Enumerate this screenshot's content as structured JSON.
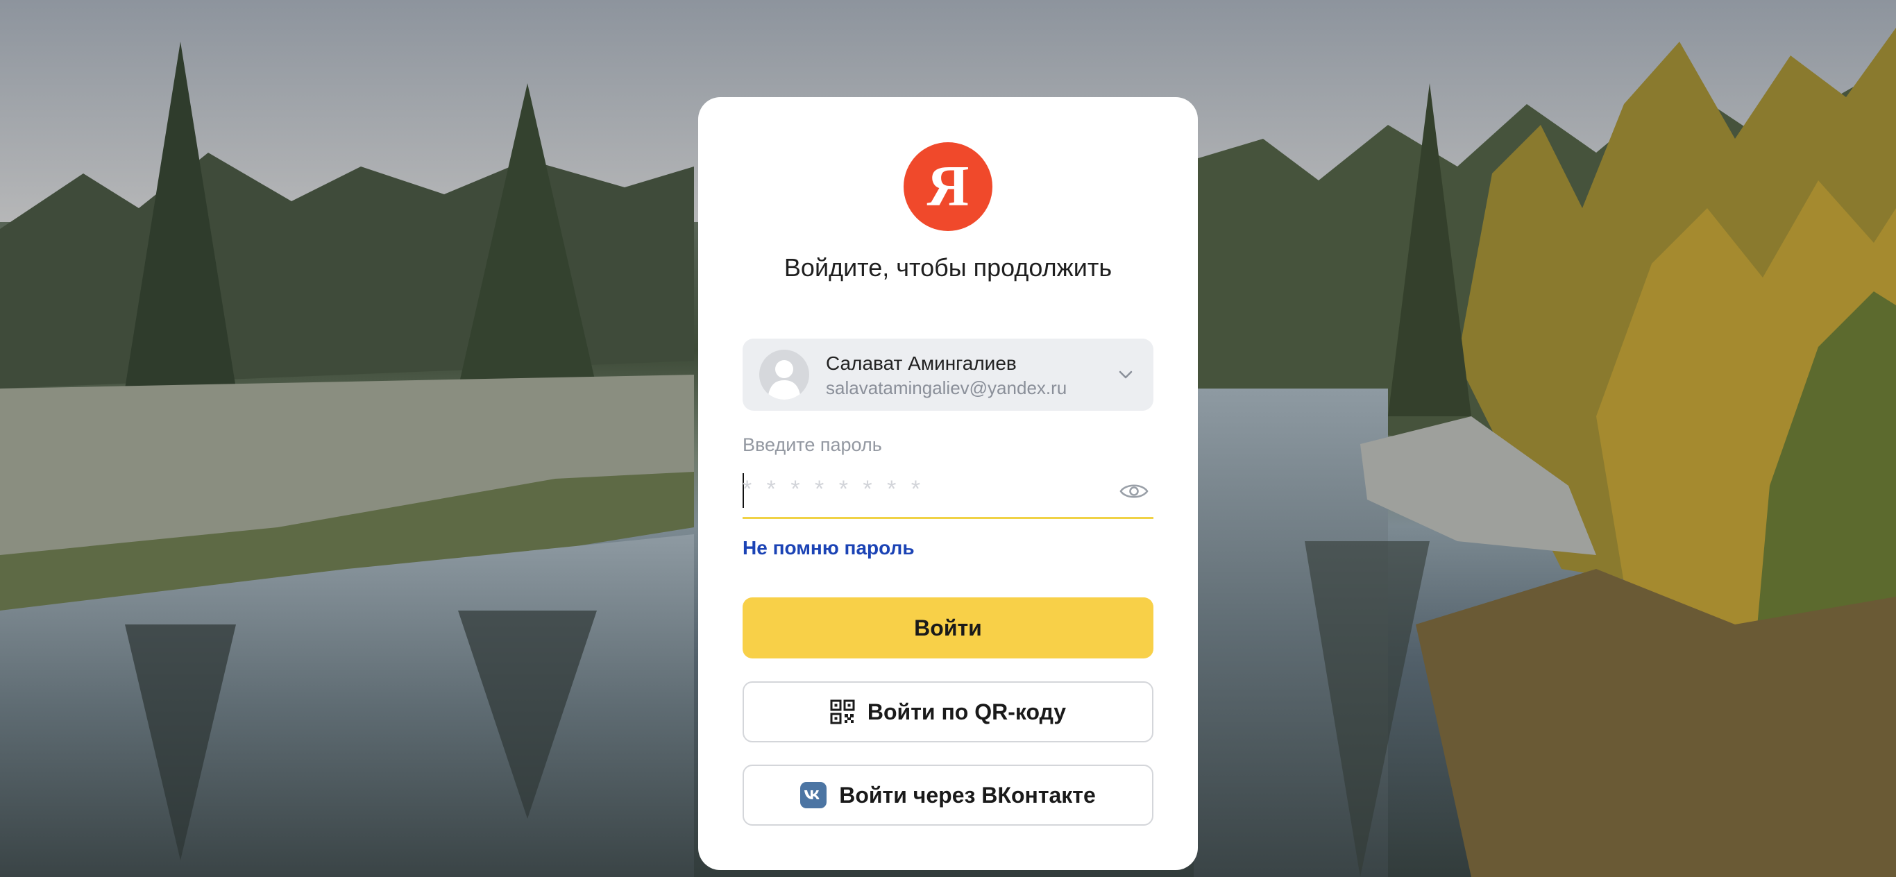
{
  "page": {
    "heading": "Войдите, чтобы продолжить",
    "logo_letter": "Я",
    "logo_color": "#f0492b",
    "accent_color": "#f8d048",
    "link_color": "#1b43b5"
  },
  "account": {
    "name": "Салават Амингалиев",
    "email": "salavatamingaliev@yandex.ru",
    "icon": "chevron-down-icon"
  },
  "password": {
    "label": "Введите пароль",
    "value": "",
    "placeholder": "* * * * * * * *",
    "icon": "eye-icon"
  },
  "links": {
    "forgot": "Не помню пароль"
  },
  "buttons": {
    "login": "Войти",
    "qr": "Войти по QR-коду",
    "qr_icon": "qr-code-icon",
    "vk": "Войти через ВКонтакте",
    "vk_icon": "vk-icon"
  }
}
